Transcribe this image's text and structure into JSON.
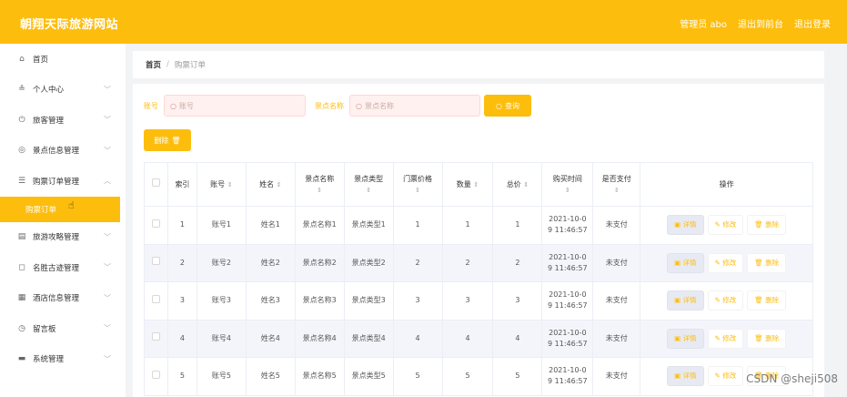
{
  "header": {
    "title": "朝翔天际旅游网站",
    "links": [
      "管理员 abo",
      "退出到前台",
      "退出登录"
    ]
  },
  "sidebar": {
    "items": [
      {
        "icon": "home-icon",
        "glyph": "⌂",
        "label": "首页",
        "chev": ""
      },
      {
        "icon": "user-icon",
        "glyph": "≗",
        "label": "个人中心",
        "chev": "﹀"
      },
      {
        "icon": "power-icon",
        "glyph": "⏻",
        "label": "旅客管理",
        "chev": "﹀"
      },
      {
        "icon": "compass-icon",
        "glyph": "◎",
        "label": "景点信息管理",
        "chev": "﹀"
      },
      {
        "icon": "list-icon",
        "glyph": "☰",
        "label": "购票订单管理",
        "chev": "︿"
      },
      {
        "icon": "card-icon",
        "glyph": "▤",
        "label": "旅游攻略管理",
        "chev": "﹀"
      },
      {
        "icon": "frame-icon",
        "glyph": "◻",
        "label": "名胜古迹管理",
        "chev": "﹀"
      },
      {
        "icon": "grid-icon",
        "glyph": "▦",
        "label": "酒店信息管理",
        "chev": "﹀"
      },
      {
        "icon": "clock-icon",
        "glyph": "◷",
        "label": "留言板",
        "chev": "﹀"
      },
      {
        "icon": "monitor-icon",
        "glyph": "▬",
        "label": "系统管理",
        "chev": "﹀"
      }
    ],
    "active_sub": "购票订单"
  },
  "breadcrumb": {
    "home": "首页",
    "sep": "/",
    "current": "购票订单"
  },
  "search": {
    "account_label": "账号",
    "account_placeholder": "账号",
    "spot_label": "景点名称",
    "spot_placeholder": "景点名称",
    "query_button": "查询"
  },
  "delete_button": "删除",
  "table": {
    "headers": [
      "索引",
      "账号",
      "姓名",
      "景点名称",
      "景点类型",
      "门票价格",
      "数量",
      "总价",
      "购买时间",
      "是否支付",
      "操作"
    ],
    "rows": [
      {
        "index": "1",
        "account": "账号1",
        "name": "姓名1",
        "spot": "景点名称1",
        "type": "景点类型1",
        "price": "1",
        "qty": "1",
        "total": "1",
        "time_a": "2021-10-0",
        "time_b": "9 11:46:57",
        "paid": "未支付"
      },
      {
        "index": "2",
        "account": "账号2",
        "name": "姓名2",
        "spot": "景点名称2",
        "type": "景点类型2",
        "price": "2",
        "qty": "2",
        "total": "2",
        "time_a": "2021-10-0",
        "time_b": "9 11:46:57",
        "paid": "未支付"
      },
      {
        "index": "3",
        "account": "账号3",
        "name": "姓名3",
        "spot": "景点名称3",
        "type": "景点类型3",
        "price": "3",
        "qty": "3",
        "total": "3",
        "time_a": "2021-10-0",
        "time_b": "9 11:46:57",
        "paid": "未支付"
      },
      {
        "index": "4",
        "account": "账号4",
        "name": "姓名4",
        "spot": "景点名称4",
        "type": "景点类型4",
        "price": "4",
        "qty": "4",
        "total": "4",
        "time_a": "2021-10-0",
        "time_b": "9 11:46:57",
        "paid": "未支付"
      },
      {
        "index": "5",
        "account": "账号5",
        "name": "姓名5",
        "spot": "景点名称5",
        "type": "景点类型5",
        "price": "5",
        "qty": "5",
        "total": "5",
        "time_a": "2021-10-0",
        "time_b": "9 11:46:57",
        "paid": "未支付"
      }
    ],
    "actions": {
      "detail": "详情",
      "edit": "修改",
      "delete": "删除"
    }
  },
  "watermark": "CSDN @sheji508",
  "colors": {
    "accent": "#fdbd0d",
    "input_bg": "#fff1ef"
  }
}
